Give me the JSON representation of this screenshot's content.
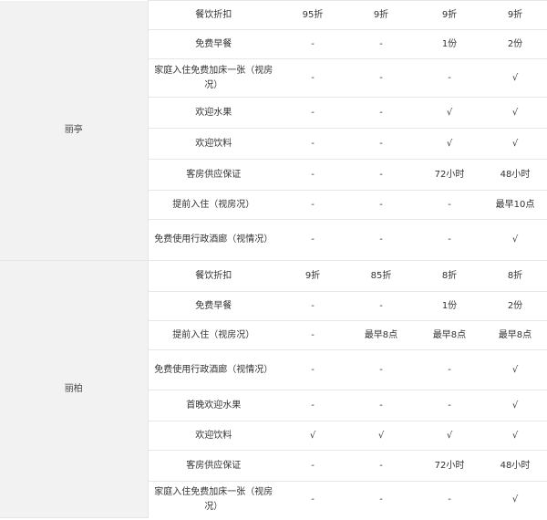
{
  "groups": [
    {
      "name": "丽亭",
      "rows": [
        {
          "item": "餐饮折扣",
          "values": [
            "95折",
            "9折",
            "9折",
            "9折"
          ]
        },
        {
          "item": "免费早餐",
          "values": [
            "-",
            "-",
            "1份",
            "2份"
          ]
        },
        {
          "item": "家庭入住免费加床一张（视房况）",
          "values": [
            "-",
            "-",
            "-",
            "√"
          ]
        },
        {
          "item": "欢迎水果",
          "values": [
            "-",
            "-",
            "√",
            "√"
          ]
        },
        {
          "item": "欢迎饮料",
          "values": [
            "-",
            "-",
            "√",
            "√"
          ]
        },
        {
          "item": "客房供应保证",
          "values": [
            "-",
            "-",
            "72小时",
            "48小时"
          ]
        },
        {
          "item": "提前入住（视房况）",
          "values": [
            "-",
            "-",
            "-",
            "最早10点"
          ]
        },
        {
          "item": "免费使用行政酒廊（视情况）",
          "values": [
            "-",
            "-",
            "-",
            "√"
          ]
        }
      ]
    },
    {
      "name": "丽柏",
      "rows": [
        {
          "item": "餐饮折扣",
          "values": [
            "9折",
            "85折",
            "8折",
            "8折"
          ]
        },
        {
          "item": "免费早餐",
          "values": [
            "-",
            "-",
            "1份",
            "2份"
          ]
        },
        {
          "item": "提前入住（视房况）",
          "values": [
            "-",
            "最早8点",
            "最早8点",
            "最早8点"
          ]
        },
        {
          "item": "免费使用行政酒廊（视情况）",
          "values": [
            "-",
            "-",
            "-",
            "√"
          ]
        },
        {
          "item": "首晚欢迎水果",
          "values": [
            "-",
            "-",
            "-",
            "√"
          ]
        },
        {
          "item": "欢迎饮料",
          "values": [
            "√",
            "√",
            "√",
            "√"
          ]
        },
        {
          "item": "客房供应保证",
          "values": [
            "-",
            "-",
            "72小时",
            "48小时"
          ]
        },
        {
          "item": "家庭入住免费加床一张（视房况）",
          "values": [
            "-",
            "-",
            "-",
            "√"
          ]
        }
      ]
    }
  ]
}
